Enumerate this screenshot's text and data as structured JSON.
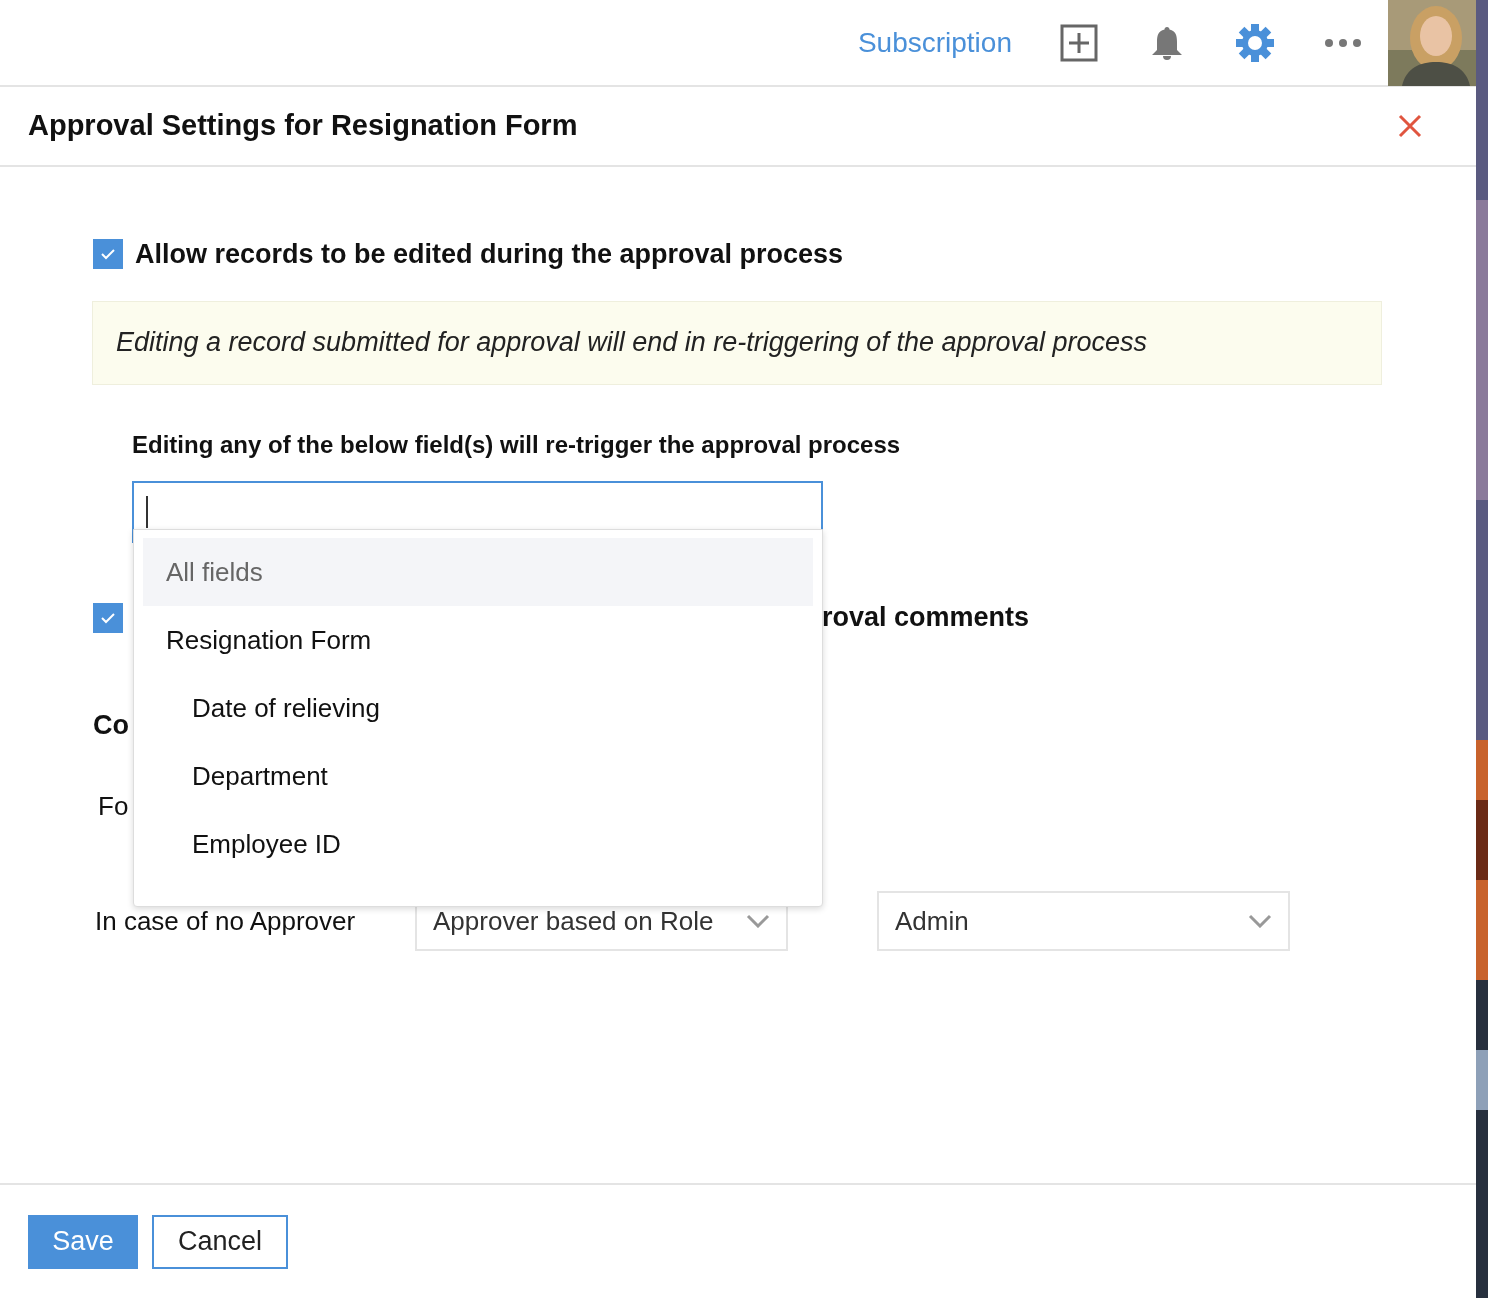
{
  "header": {
    "link": "Subscription"
  },
  "dialog": {
    "title": "Approval Settings for Resignation Form",
    "edit_option": {
      "label": "Allow records to be edited during the approval process",
      "checked": true
    },
    "note": "Editing a record submitted for approval will end in re-triggering of the approval process",
    "fields_label": "Editing any of the below field(s) will re-trigger the approval process",
    "dropdown": {
      "items": [
        {
          "label": "All fields",
          "selected": true
        },
        {
          "label": "Resignation Form",
          "selected": false,
          "children": [
            {
              "label": "Date of relieving",
              "selected": false
            },
            {
              "label": "Department",
              "selected": false
            },
            {
              "label": "Employee ID",
              "selected": false
            }
          ]
        }
      ]
    },
    "comments_option": {
      "label": "roval comments",
      "checked": true
    },
    "section_heading": "Co",
    "form_label": "Fo",
    "no_approver": {
      "label": "In case of no Approver",
      "type_select": "Approver based on Role",
      "user_select": "Admin"
    },
    "buttons": [
      "Save",
      "Cancel"
    ]
  }
}
